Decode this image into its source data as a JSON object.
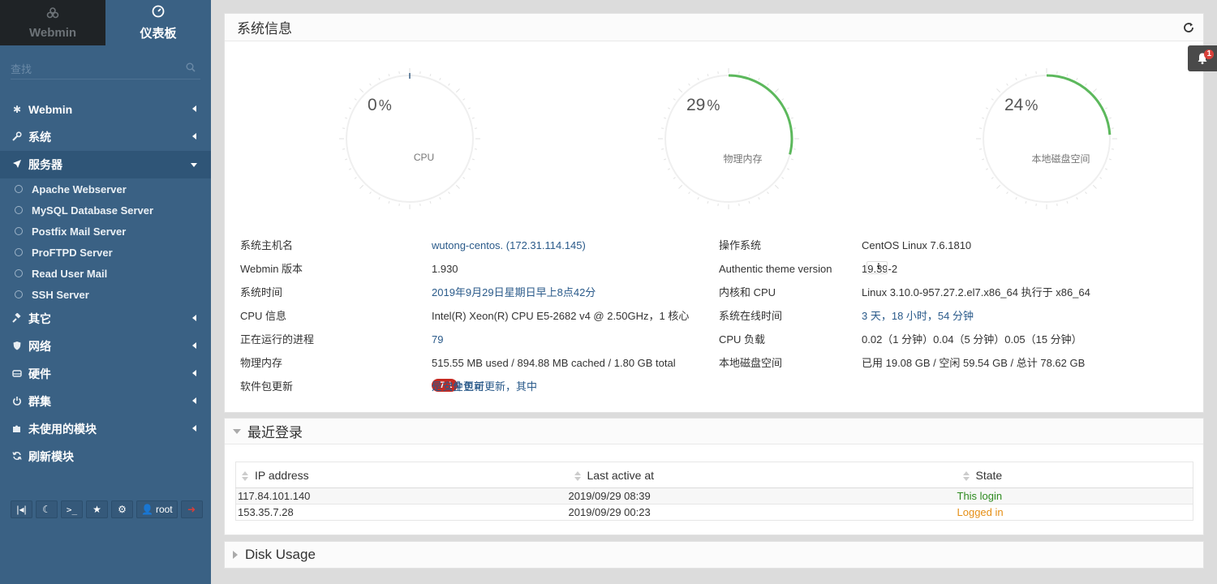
{
  "sidebar": {
    "tabs": [
      {
        "label": "Webmin",
        "icon": "webmin-icon"
      },
      {
        "label": "仪表板",
        "icon": "dashboard-icon"
      }
    ],
    "search_placeholder": "查找",
    "menu": [
      {
        "label": "Webmin",
        "icon": "gear-icon"
      },
      {
        "label": "系统",
        "icon": "wrench-icon"
      },
      {
        "label": "服务器",
        "icon": "rocket-icon"
      },
      {
        "label": "其它",
        "icon": "gavel-icon"
      },
      {
        "label": "网络",
        "icon": "shield-icon"
      },
      {
        "label": "硬件",
        "icon": "hdd-icon"
      },
      {
        "label": "群集",
        "icon": "power-icon"
      },
      {
        "label": "未使用的模块",
        "icon": "puzzle-icon"
      },
      {
        "label": "刷新模块",
        "icon": "refresh-icon"
      }
    ],
    "server_items": [
      "Apache Webserver",
      "MySQL Database Server",
      "Postfix Mail Server",
      "ProFTPD Server",
      "Read User Mail",
      "SSH Server"
    ],
    "tools": {
      "user": "root"
    }
  },
  "system_info": {
    "title": "系统信息",
    "gauges": [
      {
        "value": "0",
        "percent": 0,
        "label": "CPU"
      },
      {
        "value": "29",
        "percent": 29,
        "label": "物理内存"
      },
      {
        "value": "24",
        "percent": 24,
        "label": "本地磁盘空间"
      }
    ],
    "pct_symbol": "%",
    "rows": {
      "hostname_label": "系统主机名",
      "hostname_value": "wutong-centos. (172.31.114.145)",
      "os_label": "操作系统",
      "os_value": "CentOS Linux 7.6.1810",
      "webmin_version_label": "Webmin 版本",
      "webmin_version_value": "1.930",
      "theme_label": "Authentic theme version",
      "theme_value": "19.39-2",
      "time_label": "系统时间",
      "time_value": "2019年9月29日星期日早上8点42分",
      "kernel_label": "内核和 CPU",
      "kernel_value": "Linux 3.10.0-957.27.2.el7.x86_64 执行于 x86_64",
      "cpu_info_label": "CPU 信息",
      "cpu_info_value": "Intel(R) Xeon(R) CPU E5-2682 v4 @ 2.50GHz，1 核心",
      "uptime_label": "系统在线时间",
      "uptime_value": "3 天，18 小时，54 分钟",
      "procs_label": "正在运行的进程",
      "procs_value": "79",
      "load_label": "CPU 负载",
      "load_value": "0.02（1 分钟）0.04（5 分钟）0.05（15 分钟）",
      "mem_label": "物理内存",
      "mem_value": "515.55 MB used / 894.88 MB cached / 1.80 GB total",
      "disk_label": "本地磁盘空间",
      "disk_value": "已用 19.08 GB / 空闲 59.54 GB / 总计 78.62 GB",
      "updates_label": "软件包更新",
      "updates_count": "261",
      "updates_text": "个软件包可更新，其中",
      "security_count": "7",
      "security_text": "是安全更新"
    }
  },
  "recent_logins": {
    "title": "最近登录",
    "columns": [
      "IP address",
      "Last active at",
      "State"
    ],
    "rows": [
      {
        "ip": "117.84.101.140",
        "time": "2019/09/29 08:39",
        "state": "This login"
      },
      {
        "ip": "153.35.7.28",
        "time": "2019/09/29 00:23",
        "state": "Logged in"
      }
    ]
  },
  "disk_usage": {
    "title": "Disk Usage"
  },
  "notifications": {
    "count": "1"
  },
  "colors": {
    "sidebar": "#3a6184",
    "gauge_arc": "#5cb85c",
    "badge": "#c72a21",
    "link": "#2a5a8a",
    "this_login": "#2d8a1f",
    "logged_in": "#e58e14"
  }
}
